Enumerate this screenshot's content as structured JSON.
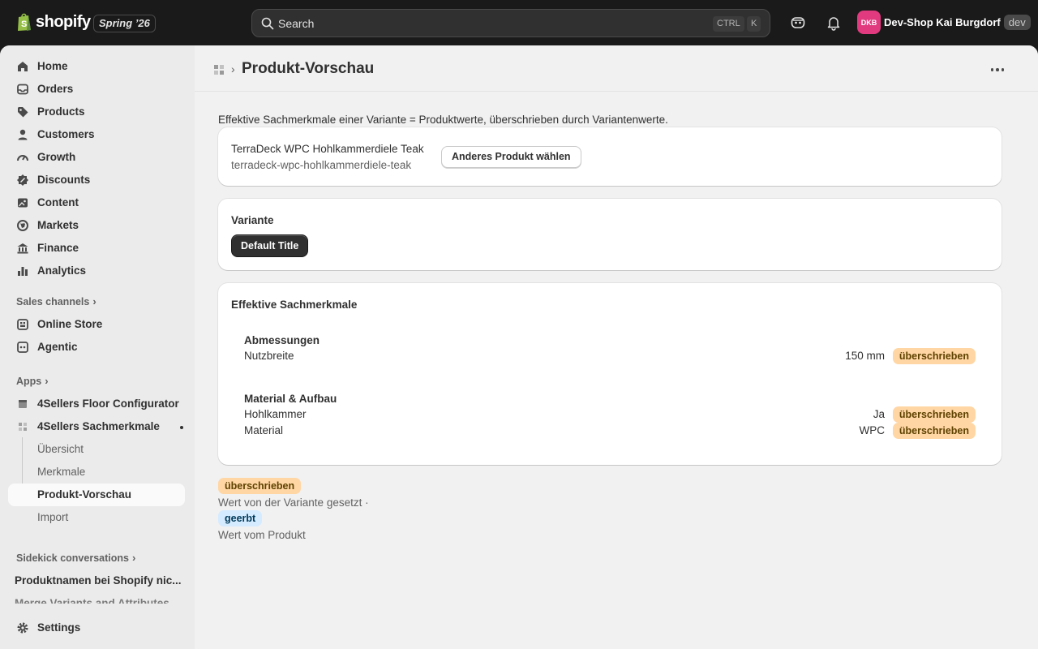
{
  "topbar": {
    "brand": "shopify",
    "edition": "Spring ’26",
    "search_placeholder": "Search",
    "kbd_ctrl": "CTRL",
    "kbd_k": "K",
    "avatar_initials": "DKB",
    "store_name": "Dev-Shop Kai Burgdorf",
    "env_badge": "dev",
    "avatar_color": "#e13a7e"
  },
  "sidebar": {
    "items": [
      {
        "label": "Home",
        "icon": "home-icon"
      },
      {
        "label": "Orders",
        "icon": "inbox-icon"
      },
      {
        "label": "Products",
        "icon": "tag-icon"
      },
      {
        "label": "Customers",
        "icon": "person-icon"
      },
      {
        "label": "Growth",
        "icon": "gauge-icon"
      },
      {
        "label": "Discounts",
        "icon": "discount-icon"
      },
      {
        "label": "Content",
        "icon": "image-icon"
      },
      {
        "label": "Markets",
        "icon": "globe-icon"
      },
      {
        "label": "Finance",
        "icon": "bank-icon"
      },
      {
        "label": "Analytics",
        "icon": "bar-chart-icon"
      }
    ],
    "sales_channels_label": "Sales channels",
    "channels": [
      {
        "label": "Online Store",
        "icon": "store-icon"
      },
      {
        "label": "Agentic",
        "icon": "agentic-icon"
      }
    ],
    "apps_label": "Apps",
    "apps": [
      {
        "label": "4Sellers Floor Configurator",
        "icon": "app-icon"
      },
      {
        "label": "4Sellers Sachmerkmale",
        "icon": "app-grid-icon"
      }
    ],
    "app_subitems": [
      "Übersicht",
      "Merkmale",
      "Produkt-Vorschau",
      "Import"
    ],
    "sidekick_label": "Sidekick conversations",
    "sidekick_items": [
      "Produktnamen bei Shopify nic...",
      "Merge Variants and Attributes"
    ],
    "settings_label": "Settings"
  },
  "page": {
    "title": "Produkt-Vorschau",
    "intro": "Effektive Sachmerkmale einer Variante = Produktwerte, überschrieben durch Variantenwerte.",
    "product_title": "TerraDeck WPC Hohlkammerdiele Teak",
    "product_handle": "terradeck-wpc-hohlkammerdiele-teak",
    "change_product_button": "Anderes Produkt wählen",
    "variant_heading": "Variante",
    "variant_selected": "Default Title",
    "attributes_heading": "Effektive Sachmerkmale",
    "groups": [
      {
        "name": "Abmessungen",
        "rows": [
          {
            "name": "Nutzbreite",
            "value": "150 mm",
            "status": "überschrieben"
          }
        ]
      },
      {
        "name": "Material & Aufbau",
        "rows": [
          {
            "name": "Hohlkammer",
            "value": "Ja",
            "status": "überschrieben"
          },
          {
            "name": "Material",
            "value": "WPC",
            "status": "überschrieben"
          }
        ]
      }
    ],
    "legend": {
      "overridden_badge": "überschrieben",
      "overridden_text": "Wert von der Variante gesetzt ·",
      "inherited_badge": "geerbt",
      "inherited_text": "Wert vom Produkt"
    }
  },
  "colors": {
    "overridden_bg": "#ffd6a4",
    "inherited_bg": "#d5ebff",
    "primary_button": "#303030"
  }
}
